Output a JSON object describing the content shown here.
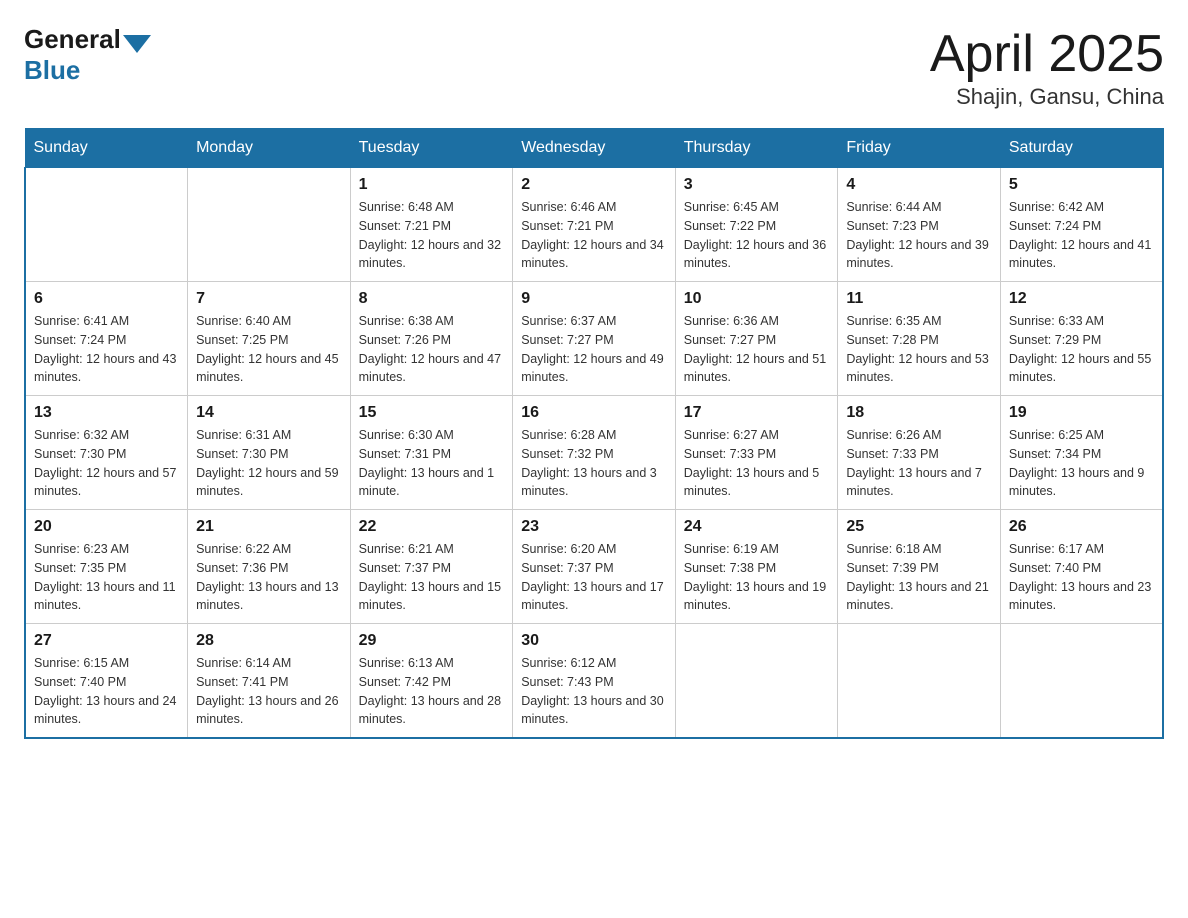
{
  "header": {
    "logo_general": "General",
    "logo_blue": "Blue",
    "month": "April 2025",
    "location": "Shajin, Gansu, China"
  },
  "days_of_week": [
    "Sunday",
    "Monday",
    "Tuesday",
    "Wednesday",
    "Thursday",
    "Friday",
    "Saturday"
  ],
  "weeks": [
    [
      {
        "day": "",
        "sunrise": "",
        "sunset": "",
        "daylight": ""
      },
      {
        "day": "",
        "sunrise": "",
        "sunset": "",
        "daylight": ""
      },
      {
        "day": "1",
        "sunrise": "Sunrise: 6:48 AM",
        "sunset": "Sunset: 7:21 PM",
        "daylight": "Daylight: 12 hours and 32 minutes."
      },
      {
        "day": "2",
        "sunrise": "Sunrise: 6:46 AM",
        "sunset": "Sunset: 7:21 PM",
        "daylight": "Daylight: 12 hours and 34 minutes."
      },
      {
        "day": "3",
        "sunrise": "Sunrise: 6:45 AM",
        "sunset": "Sunset: 7:22 PM",
        "daylight": "Daylight: 12 hours and 36 minutes."
      },
      {
        "day": "4",
        "sunrise": "Sunrise: 6:44 AM",
        "sunset": "Sunset: 7:23 PM",
        "daylight": "Daylight: 12 hours and 39 minutes."
      },
      {
        "day": "5",
        "sunrise": "Sunrise: 6:42 AM",
        "sunset": "Sunset: 7:24 PM",
        "daylight": "Daylight: 12 hours and 41 minutes."
      }
    ],
    [
      {
        "day": "6",
        "sunrise": "Sunrise: 6:41 AM",
        "sunset": "Sunset: 7:24 PM",
        "daylight": "Daylight: 12 hours and 43 minutes."
      },
      {
        "day": "7",
        "sunrise": "Sunrise: 6:40 AM",
        "sunset": "Sunset: 7:25 PM",
        "daylight": "Daylight: 12 hours and 45 minutes."
      },
      {
        "day": "8",
        "sunrise": "Sunrise: 6:38 AM",
        "sunset": "Sunset: 7:26 PM",
        "daylight": "Daylight: 12 hours and 47 minutes."
      },
      {
        "day": "9",
        "sunrise": "Sunrise: 6:37 AM",
        "sunset": "Sunset: 7:27 PM",
        "daylight": "Daylight: 12 hours and 49 minutes."
      },
      {
        "day": "10",
        "sunrise": "Sunrise: 6:36 AM",
        "sunset": "Sunset: 7:27 PM",
        "daylight": "Daylight: 12 hours and 51 minutes."
      },
      {
        "day": "11",
        "sunrise": "Sunrise: 6:35 AM",
        "sunset": "Sunset: 7:28 PM",
        "daylight": "Daylight: 12 hours and 53 minutes."
      },
      {
        "day": "12",
        "sunrise": "Sunrise: 6:33 AM",
        "sunset": "Sunset: 7:29 PM",
        "daylight": "Daylight: 12 hours and 55 minutes."
      }
    ],
    [
      {
        "day": "13",
        "sunrise": "Sunrise: 6:32 AM",
        "sunset": "Sunset: 7:30 PM",
        "daylight": "Daylight: 12 hours and 57 minutes."
      },
      {
        "day": "14",
        "sunrise": "Sunrise: 6:31 AM",
        "sunset": "Sunset: 7:30 PM",
        "daylight": "Daylight: 12 hours and 59 minutes."
      },
      {
        "day": "15",
        "sunrise": "Sunrise: 6:30 AM",
        "sunset": "Sunset: 7:31 PM",
        "daylight": "Daylight: 13 hours and 1 minute."
      },
      {
        "day": "16",
        "sunrise": "Sunrise: 6:28 AM",
        "sunset": "Sunset: 7:32 PM",
        "daylight": "Daylight: 13 hours and 3 minutes."
      },
      {
        "day": "17",
        "sunrise": "Sunrise: 6:27 AM",
        "sunset": "Sunset: 7:33 PM",
        "daylight": "Daylight: 13 hours and 5 minutes."
      },
      {
        "day": "18",
        "sunrise": "Sunrise: 6:26 AM",
        "sunset": "Sunset: 7:33 PM",
        "daylight": "Daylight: 13 hours and 7 minutes."
      },
      {
        "day": "19",
        "sunrise": "Sunrise: 6:25 AM",
        "sunset": "Sunset: 7:34 PM",
        "daylight": "Daylight: 13 hours and 9 minutes."
      }
    ],
    [
      {
        "day": "20",
        "sunrise": "Sunrise: 6:23 AM",
        "sunset": "Sunset: 7:35 PM",
        "daylight": "Daylight: 13 hours and 11 minutes."
      },
      {
        "day": "21",
        "sunrise": "Sunrise: 6:22 AM",
        "sunset": "Sunset: 7:36 PM",
        "daylight": "Daylight: 13 hours and 13 minutes."
      },
      {
        "day": "22",
        "sunrise": "Sunrise: 6:21 AM",
        "sunset": "Sunset: 7:37 PM",
        "daylight": "Daylight: 13 hours and 15 minutes."
      },
      {
        "day": "23",
        "sunrise": "Sunrise: 6:20 AM",
        "sunset": "Sunset: 7:37 PM",
        "daylight": "Daylight: 13 hours and 17 minutes."
      },
      {
        "day": "24",
        "sunrise": "Sunrise: 6:19 AM",
        "sunset": "Sunset: 7:38 PM",
        "daylight": "Daylight: 13 hours and 19 minutes."
      },
      {
        "day": "25",
        "sunrise": "Sunrise: 6:18 AM",
        "sunset": "Sunset: 7:39 PM",
        "daylight": "Daylight: 13 hours and 21 minutes."
      },
      {
        "day": "26",
        "sunrise": "Sunrise: 6:17 AM",
        "sunset": "Sunset: 7:40 PM",
        "daylight": "Daylight: 13 hours and 23 minutes."
      }
    ],
    [
      {
        "day": "27",
        "sunrise": "Sunrise: 6:15 AM",
        "sunset": "Sunset: 7:40 PM",
        "daylight": "Daylight: 13 hours and 24 minutes."
      },
      {
        "day": "28",
        "sunrise": "Sunrise: 6:14 AM",
        "sunset": "Sunset: 7:41 PM",
        "daylight": "Daylight: 13 hours and 26 minutes."
      },
      {
        "day": "29",
        "sunrise": "Sunrise: 6:13 AM",
        "sunset": "Sunset: 7:42 PM",
        "daylight": "Daylight: 13 hours and 28 minutes."
      },
      {
        "day": "30",
        "sunrise": "Sunrise: 6:12 AM",
        "sunset": "Sunset: 7:43 PM",
        "daylight": "Daylight: 13 hours and 30 minutes."
      },
      {
        "day": "",
        "sunrise": "",
        "sunset": "",
        "daylight": ""
      },
      {
        "day": "",
        "sunrise": "",
        "sunset": "",
        "daylight": ""
      },
      {
        "day": "",
        "sunrise": "",
        "sunset": "",
        "daylight": ""
      }
    ]
  ]
}
